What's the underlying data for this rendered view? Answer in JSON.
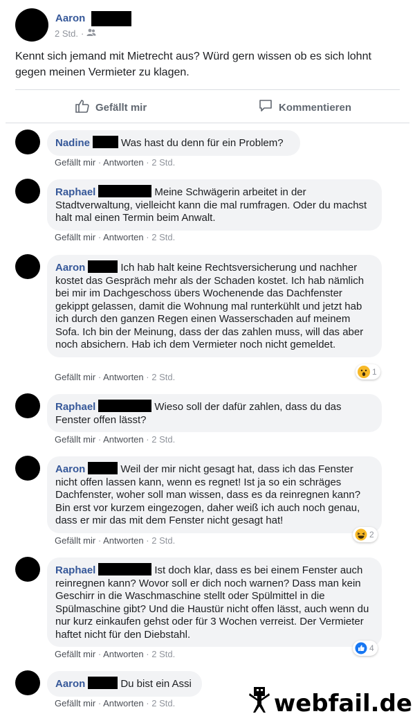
{
  "post": {
    "author": "Aaron",
    "time": "2 Std.",
    "privacy_icon": "friends-icon",
    "text": "Kennt sich jemand mit Mietrecht aus? Würd gern wissen ob es sich lohnt gegen meinen Vermieter zu klagen.",
    "like_label": "Gefällt mir",
    "comment_label": "Kommentieren"
  },
  "comment_actions": {
    "like": "Gefällt mir",
    "reply": "Antworten",
    "sep": "·"
  },
  "comments": [
    {
      "author": "Nadine",
      "text": "Was hast du denn für ein Problem?",
      "time": "2 Std."
    },
    {
      "author": "Raphael",
      "text": "Meine Schwägerin arbeitet in der Stadtverwaltung, vielleicht kann die mal rumfragen. Oder du machst halt mal einen Termin beim Anwalt.",
      "time": "2 Std."
    },
    {
      "author": "Aaron",
      "text": "Ich hab halt keine Rechtsversicherung und nachher kostet das Gespräch mehr als der Schaden kostet. Ich hab nämlich bei mir im Dachgeschoss übers Wochenende das Dachfenster gekippt gelassen, damit die Wohnung mal runterkühlt und jetzt hab ich durch den ganzen Regen einen Wasserschaden auf meinem Sofa. Ich bin der Meinung, dass der das zahlen muss, will das aber noch absichern. Hab ich dem Vermieter noch nicht gemeldet.",
      "time": "2 Std.",
      "reaction": {
        "icon": "wow-emoji-icon",
        "count": "1"
      }
    },
    {
      "author": "Raphael",
      "text": "Wieso soll der dafür zahlen, dass du das Fenster offen lässt?",
      "time": "2 Std."
    },
    {
      "author": "Aaron",
      "text": "Weil der mir nicht gesagt hat, dass ich das Fenster nicht offen lassen kann, wenn es regnet! Ist ja so ein schräges Dachfenster, woher soll man wissen, dass es da reinregnen kann? Bin erst vor kurzem eingezogen, daher weiß ich auch noch genau, dass er mir das mit dem Fenster nicht gesagt hat!",
      "time": "2 Std.",
      "reaction": {
        "icon": "haha-emoji-icon",
        "count": "2"
      }
    },
    {
      "author": "Raphael",
      "text": "Ist doch klar, dass es bei einem Fenster auch reinregnen kann? Wovor soll er dich noch warnen? Dass man kein Geschirr in die Waschmaschine stellt oder Spülmittel in die Spülmaschine gibt? Und die Haustür nicht offen lässt, auch wenn du nur kurz einkaufen gehst oder für 3 Wochen verreist. Der Vermieter haftet nicht für den Diebstahl.",
      "time": "2 Std.",
      "reaction": {
        "icon": "like-emoji-icon",
        "count": "4"
      }
    },
    {
      "author": "Aaron",
      "text": "Du bist ein Assi",
      "time": "2 Std."
    }
  ],
  "watermark": {
    "text": "webfail.de",
    "icon": "webfail-mascot-icon"
  },
  "colors": {
    "name": "#365899",
    "bubble": "#f2f3f5",
    "meta": "#90949c"
  }
}
